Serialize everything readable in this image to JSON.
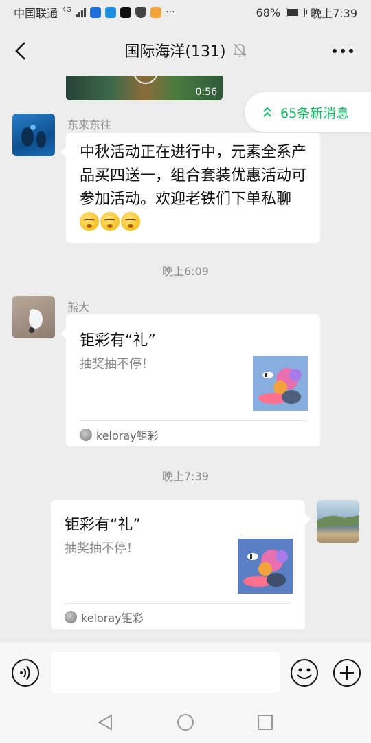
{
  "status_bar": {
    "carrier": "中国联通",
    "network": "4G",
    "battery_percent": "68%",
    "battery_level": 0.68,
    "time": "晚上7:39",
    "more_dots": "···"
  },
  "nav": {
    "title": "国际海洋(131)",
    "muted": true
  },
  "video_message": {
    "duration": "0:56"
  },
  "new_messages_pill": {
    "label": "65条新消息"
  },
  "messages": [
    {
      "type": "text",
      "sender": "东来东往",
      "text": "中秋活动正在进行中，元素全系产品买四送一，组合套装优惠活动可参加活动。欢迎老铁们下单私聊",
      "emoji_count": 3
    },
    {
      "type": "timestamp",
      "text": "晚上6:09"
    },
    {
      "type": "link_card",
      "sender": "熊大",
      "title": "钜彩有“礼”",
      "description": "抽奖抽不停！",
      "source": "keloray钜彩"
    },
    {
      "type": "timestamp",
      "text": "晚上7:39"
    },
    {
      "type": "link_card",
      "sender": "self",
      "title": "钜彩有“礼”",
      "description": "抽奖抽不停！",
      "source": "keloray钜彩"
    }
  ],
  "input": {
    "placeholder": ""
  },
  "colors": {
    "accent": "#07c160",
    "background": "#ededed",
    "bubble": "#ffffff"
  },
  "icons": {
    "back": "chevron-left-icon",
    "mute": "bell-off-icon",
    "more": "more-dots-icon",
    "voice": "voice-icon",
    "emoji": "smiley-icon",
    "plus": "plus-circle-icon"
  }
}
